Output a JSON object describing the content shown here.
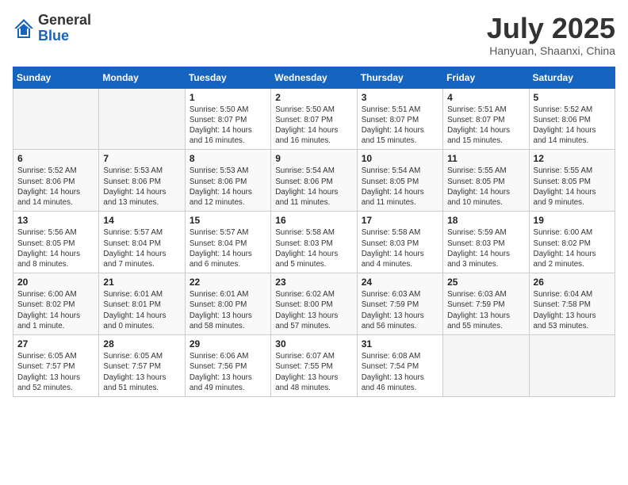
{
  "header": {
    "logo_general": "General",
    "logo_blue": "Blue",
    "month_year": "July 2025",
    "location": "Hanyuan, Shaanxi, China"
  },
  "days_of_week": [
    "Sunday",
    "Monday",
    "Tuesday",
    "Wednesday",
    "Thursday",
    "Friday",
    "Saturday"
  ],
  "weeks": [
    [
      {
        "num": "",
        "empty": true
      },
      {
        "num": "",
        "empty": true
      },
      {
        "num": "1",
        "sunrise": "5:50 AM",
        "sunset": "8:07 PM",
        "daylight": "14 hours and 16 minutes."
      },
      {
        "num": "2",
        "sunrise": "5:50 AM",
        "sunset": "8:07 PM",
        "daylight": "14 hours and 16 minutes."
      },
      {
        "num": "3",
        "sunrise": "5:51 AM",
        "sunset": "8:07 PM",
        "daylight": "14 hours and 15 minutes."
      },
      {
        "num": "4",
        "sunrise": "5:51 AM",
        "sunset": "8:07 PM",
        "daylight": "14 hours and 15 minutes."
      },
      {
        "num": "5",
        "sunrise": "5:52 AM",
        "sunset": "8:06 PM",
        "daylight": "14 hours and 14 minutes."
      }
    ],
    [
      {
        "num": "6",
        "sunrise": "5:52 AM",
        "sunset": "8:06 PM",
        "daylight": "14 hours and 14 minutes."
      },
      {
        "num": "7",
        "sunrise": "5:53 AM",
        "sunset": "8:06 PM",
        "daylight": "14 hours and 13 minutes."
      },
      {
        "num": "8",
        "sunrise": "5:53 AM",
        "sunset": "8:06 PM",
        "daylight": "14 hours and 12 minutes."
      },
      {
        "num": "9",
        "sunrise": "5:54 AM",
        "sunset": "8:06 PM",
        "daylight": "14 hours and 11 minutes."
      },
      {
        "num": "10",
        "sunrise": "5:54 AM",
        "sunset": "8:05 PM",
        "daylight": "14 hours and 11 minutes."
      },
      {
        "num": "11",
        "sunrise": "5:55 AM",
        "sunset": "8:05 PM",
        "daylight": "14 hours and 10 minutes."
      },
      {
        "num": "12",
        "sunrise": "5:55 AM",
        "sunset": "8:05 PM",
        "daylight": "14 hours and 9 minutes."
      }
    ],
    [
      {
        "num": "13",
        "sunrise": "5:56 AM",
        "sunset": "8:05 PM",
        "daylight": "14 hours and 8 minutes."
      },
      {
        "num": "14",
        "sunrise": "5:57 AM",
        "sunset": "8:04 PM",
        "daylight": "14 hours and 7 minutes."
      },
      {
        "num": "15",
        "sunrise": "5:57 AM",
        "sunset": "8:04 PM",
        "daylight": "14 hours and 6 minutes."
      },
      {
        "num": "16",
        "sunrise": "5:58 AM",
        "sunset": "8:03 PM",
        "daylight": "14 hours and 5 minutes."
      },
      {
        "num": "17",
        "sunrise": "5:58 AM",
        "sunset": "8:03 PM",
        "daylight": "14 hours and 4 minutes."
      },
      {
        "num": "18",
        "sunrise": "5:59 AM",
        "sunset": "8:03 PM",
        "daylight": "14 hours and 3 minutes."
      },
      {
        "num": "19",
        "sunrise": "6:00 AM",
        "sunset": "8:02 PM",
        "daylight": "14 hours and 2 minutes."
      }
    ],
    [
      {
        "num": "20",
        "sunrise": "6:00 AM",
        "sunset": "8:02 PM",
        "daylight": "14 hours and 1 minute."
      },
      {
        "num": "21",
        "sunrise": "6:01 AM",
        "sunset": "8:01 PM",
        "daylight": "14 hours and 0 minutes."
      },
      {
        "num": "22",
        "sunrise": "6:01 AM",
        "sunset": "8:00 PM",
        "daylight": "13 hours and 58 minutes."
      },
      {
        "num": "23",
        "sunrise": "6:02 AM",
        "sunset": "8:00 PM",
        "daylight": "13 hours and 57 minutes."
      },
      {
        "num": "24",
        "sunrise": "6:03 AM",
        "sunset": "7:59 PM",
        "daylight": "13 hours and 56 minutes."
      },
      {
        "num": "25",
        "sunrise": "6:03 AM",
        "sunset": "7:59 PM",
        "daylight": "13 hours and 55 minutes."
      },
      {
        "num": "26",
        "sunrise": "6:04 AM",
        "sunset": "7:58 PM",
        "daylight": "13 hours and 53 minutes."
      }
    ],
    [
      {
        "num": "27",
        "sunrise": "6:05 AM",
        "sunset": "7:57 PM",
        "daylight": "13 hours and 52 minutes."
      },
      {
        "num": "28",
        "sunrise": "6:05 AM",
        "sunset": "7:57 PM",
        "daylight": "13 hours and 51 minutes."
      },
      {
        "num": "29",
        "sunrise": "6:06 AM",
        "sunset": "7:56 PM",
        "daylight": "13 hours and 49 minutes."
      },
      {
        "num": "30",
        "sunrise": "6:07 AM",
        "sunset": "7:55 PM",
        "daylight": "13 hours and 48 minutes."
      },
      {
        "num": "31",
        "sunrise": "6:08 AM",
        "sunset": "7:54 PM",
        "daylight": "13 hours and 46 minutes."
      },
      {
        "num": "",
        "empty": true
      },
      {
        "num": "",
        "empty": true
      }
    ]
  ],
  "labels": {
    "sunrise_prefix": "Sunrise: ",
    "sunset_prefix": "Sunset: ",
    "daylight_prefix": "Daylight: "
  }
}
